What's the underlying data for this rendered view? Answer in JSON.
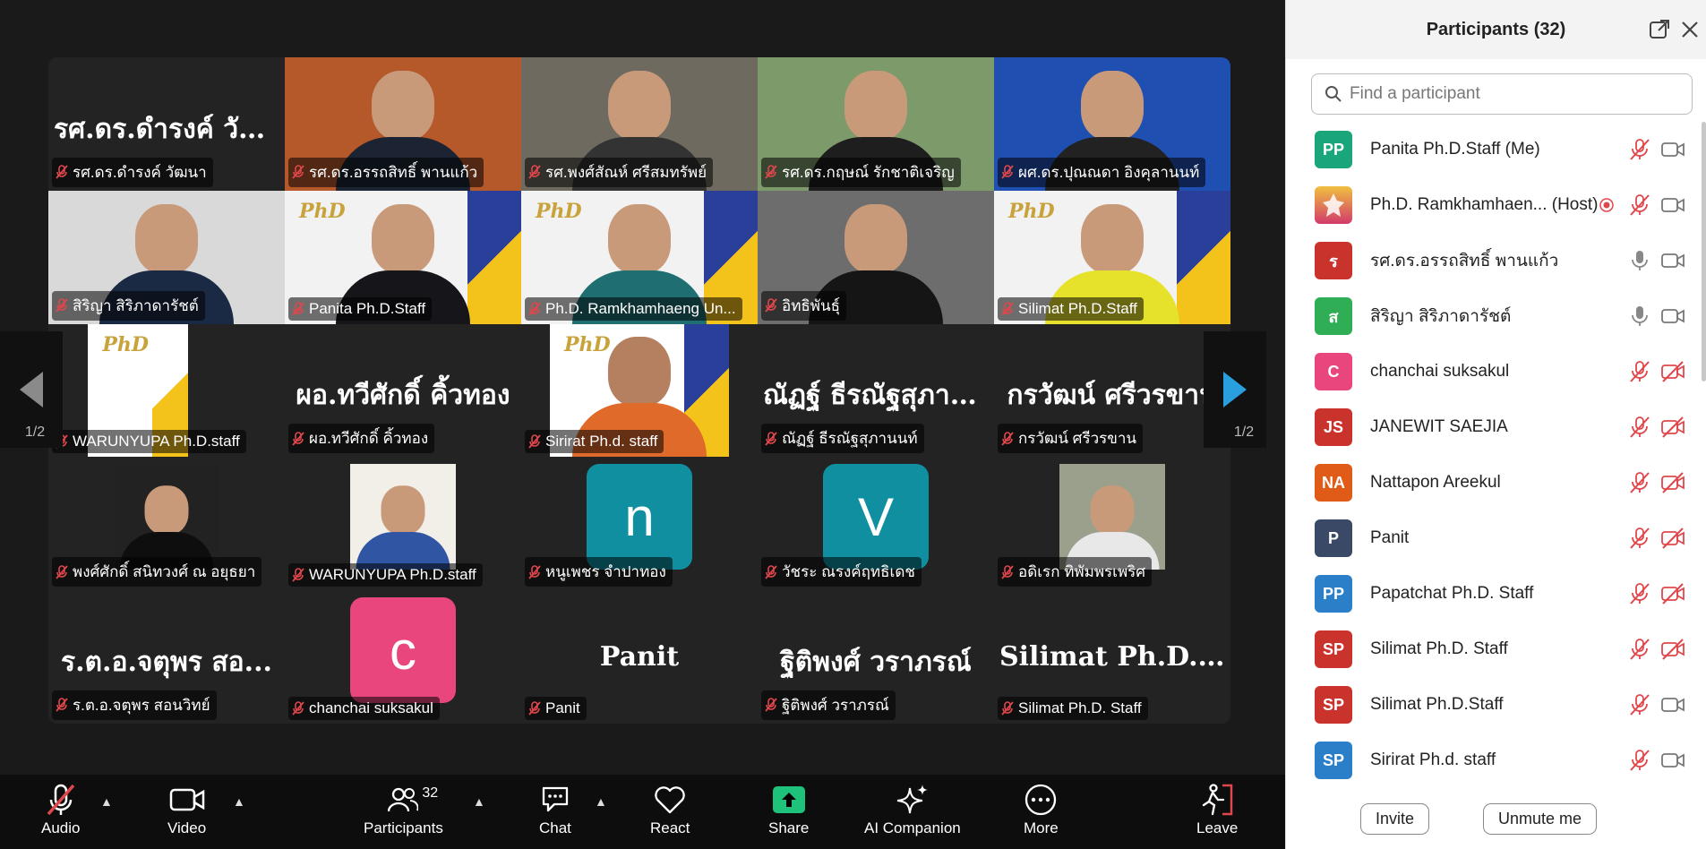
{
  "colors": {
    "mic_off": "#e0474c",
    "active_speaker": "#23d160",
    "share": "#1ec27a",
    "arrow": "#2a9fe0"
  },
  "panel": {
    "title": "Participants (32)",
    "search_placeholder": "Find a participant",
    "invite_label": "Invite",
    "unmute_me_label": "Unmute me",
    "participants": [
      {
        "initials": "PP",
        "name": "Panita Ph.D.Staff (Me)",
        "color": "#1aa57a",
        "mic": "off",
        "video": "on"
      },
      {
        "initials": "",
        "name": "Ph.D. Ramkhamhaen... (Host)",
        "color": "#d23a6a",
        "mic": "off",
        "video": "on",
        "recording": true
      },
      {
        "initials": "ร",
        "name": "รศ.ดร.อรรถสิทธิ์ พานแก้ว",
        "color": "#c9332c",
        "mic": "on",
        "video": "on"
      },
      {
        "initials": "ส",
        "name": "สิริญา สิริภาดารัชต์",
        "color": "#2fae55",
        "mic": "on",
        "video": "on"
      },
      {
        "initials": "C",
        "name": "chanchai suksakul",
        "color": "#e8467c",
        "mic": "off",
        "video": "off"
      },
      {
        "initials": "JS",
        "name": "JANEWIT SAEJIA",
        "color": "#c9332c",
        "mic": "off",
        "video": "off"
      },
      {
        "initials": "NA",
        "name": "Nattapon Areekul",
        "color": "#e05a18",
        "mic": "off",
        "video": "off"
      },
      {
        "initials": "P",
        "name": "Panit",
        "color": "#3a4a66",
        "mic": "off",
        "video": "off"
      },
      {
        "initials": "PP",
        "name": "Papatchat Ph.D. Staff",
        "color": "#2a7fc8",
        "mic": "off",
        "video": "off"
      },
      {
        "initials": "SP",
        "name": "Silimat Ph.D. Staff",
        "color": "#c9332c",
        "mic": "off",
        "video": "off"
      },
      {
        "initials": "SP",
        "name": "Silimat Ph.D.Staff",
        "color": "#c9332c",
        "mic": "off",
        "video": "on"
      },
      {
        "initials": "SP",
        "name": "Sirirat Ph.d. staff",
        "color": "#2a7fc8",
        "mic": "off",
        "video": "on"
      }
    ]
  },
  "pager": {
    "page": "1/2"
  },
  "tiles": [
    {
      "label": "รศ.ดร.ดำรงค์ วัฒนา",
      "bigname": "รศ.ดร.ดำรงค์ วัฒ...",
      "kind": "name"
    },
    {
      "label": "รศ.ดร.อรรถสิทธิ์ พานแก้ว",
      "kind": "video",
      "bg": "#b5582a",
      "shirt": "#1c2433",
      "active": true
    },
    {
      "label": "รศ.พงศ์สัณห์ ศรีสมทรัพย์",
      "kind": "video",
      "bg": "#6f6a60",
      "shirt": "#333"
    },
    {
      "label": "รศ.ดร.กฤษณ์ รักชาติเจริญ",
      "kind": "video",
      "bg": "#7d9a6a",
      "shirt": "#1e1e1e"
    },
    {
      "label": "ผศ.ดร.ปุณณดา อิงคุลานนท์",
      "kind": "video",
      "bg": "#1f4fb0",
      "shirt": "#222"
    },
    {
      "label": "สิริญา สิริภาดารัชต์",
      "kind": "video",
      "bg": "#d9d9d9",
      "shirt": "#1b2a44"
    },
    {
      "label": "Panita Ph.D.Staff",
      "kind": "video",
      "bg": "#f2f2f2",
      "shirt": "#15151a"
    },
    {
      "label": "Ph.D. Ramkhamhaeng Un...",
      "kind": "video",
      "bg": "#f2f2f2",
      "shirt": "#1f6f72"
    },
    {
      "label": "อิทธิพันธุ์",
      "kind": "video",
      "bg": "#6d6d6d",
      "shirt": "#151515"
    },
    {
      "label": "Silimat Ph.D.Staff",
      "kind": "video",
      "bg": "#f2f2f2",
      "shirt": "#e6e22c"
    },
    {
      "label": "WARUNYUPA Ph.D.staff",
      "kind": "card"
    },
    {
      "label": "ผอ.ทวีศักดิ์ คิ้วทอง",
      "bigname": "ผอ.ทวีศักดิ์  คิ้วทอง",
      "kind": "name"
    },
    {
      "label": "Sirirat Ph.d. staff",
      "kind": "card-person"
    },
    {
      "label": "ณัฏฐ์ ธีรณัฐสุภานนท์",
      "bigname": "ณัฏฐ์ ธีรณัฐสุภาน...",
      "kind": "name"
    },
    {
      "label": "กรวัฒน์ ศรีวรขาน",
      "bigname": "กรวัฒน์ ศรีวรขาน",
      "kind": "name"
    },
    {
      "label": "พงศ์ศักดิ์ สนิทวงศ์ ณ อยุธยา",
      "kind": "photo",
      "bg": "#222",
      "shirt": "#0e0e0e"
    },
    {
      "label": "WARUNYUPA Ph.D.staff",
      "kind": "photo",
      "bg": "#f1efe8",
      "shirt": "#2f55a3"
    },
    {
      "label": "หนูเพชร จำปาทอง",
      "kind": "avatar",
      "letter": "n",
      "color": "#0f8f9f"
    },
    {
      "label": "วัชระ ณรงค์ฤทธิเดช",
      "kind": "avatar",
      "letter": "V",
      "color": "#0f8f9f"
    },
    {
      "label": "อดิเรก ทิพัมพรเพริศ",
      "kind": "photo",
      "bg": "#9aa08c",
      "shirt": "#e8e8e8"
    },
    {
      "label": "ร.ต.อ.จตุพร  สอนวิทย์",
      "bigname": "ร.ต.อ.จตุพร  สอ...",
      "kind": "name"
    },
    {
      "label": "chanchai suksakul",
      "kind": "avatar",
      "letter": "c",
      "color": "#e8467c"
    },
    {
      "label": "Panit",
      "bigname": "Panit",
      "kind": "name"
    },
    {
      "label": "ฐิติพงศ์ วราภรณ์",
      "bigname": "ฐิติพงศ์ วราภรณ์",
      "kind": "name"
    },
    {
      "label": "Silimat Ph.D. Staff",
      "bigname": "Silimat Ph.D. St...",
      "kind": "name"
    }
  ],
  "toolbar": {
    "audio": "Audio",
    "video": "Video",
    "participants": "Participants",
    "participants_count": "32",
    "chat": "Chat",
    "react": "React",
    "share": "Share",
    "ai_companion": "AI Companion",
    "more": "More",
    "leave": "Leave"
  }
}
